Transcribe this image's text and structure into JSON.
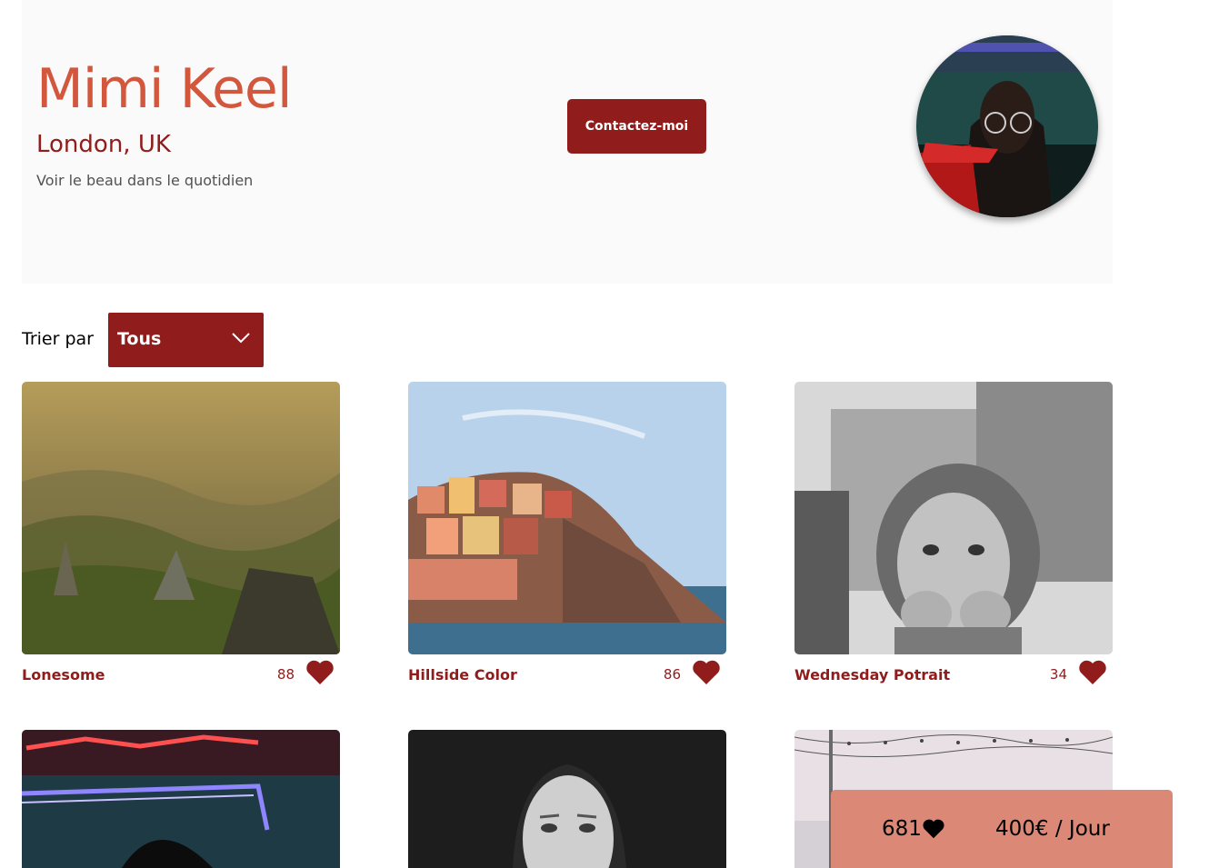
{
  "photographer": {
    "name": "Mimi Keel",
    "location": "London, UK",
    "tagline": "Voir le beau dans le quotidien",
    "contact_label": "Contactez-moi",
    "avatar_icon": "portrait-photo"
  },
  "sort": {
    "label": "Trier par",
    "selected": "Tous"
  },
  "gallery": [
    {
      "title": "Lonesome",
      "likes": "88"
    },
    {
      "title": "Hillside Color",
      "likes": "86"
    },
    {
      "title": "Wednesday Potrait",
      "likes": "34"
    },
    {
      "title": "",
      "likes": ""
    },
    {
      "title": "",
      "likes": ""
    },
    {
      "title": "",
      "likes": ""
    }
  ],
  "stats": {
    "total_likes": "681",
    "rate": "400€ / Jour"
  },
  "colors": {
    "primary": "#901c1c",
    "accent": "#d3573c",
    "stats_bg": "#db8876",
    "header_bg": "#fafafa"
  }
}
